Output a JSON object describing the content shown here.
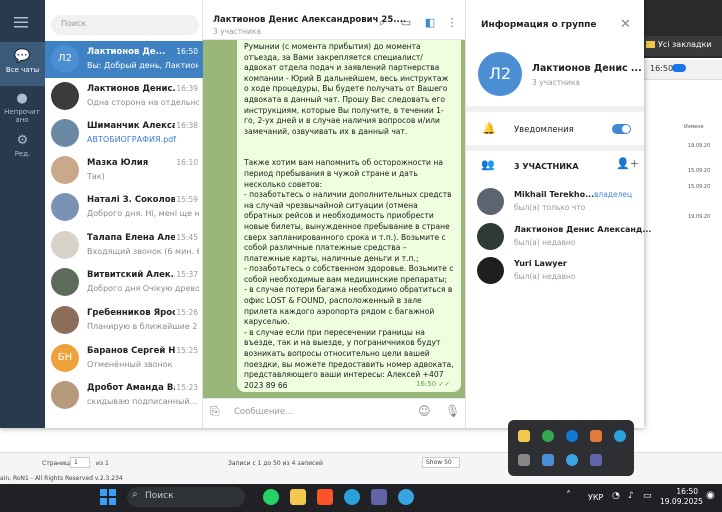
{
  "background_app": {
    "bookmarks_label": "Усі закладки",
    "clock": "16:50",
    "column_header": "Измене",
    "cells": [
      "19.09.20",
      "15.09.20",
      "15.09.20",
      "19.09.20"
    ],
    "footer": {
      "page_label": "Страница",
      "page_value": "1",
      "of_label": "из 1",
      "records": "Записи с 1 до 50 из 4 записей",
      "show": "Show 50",
      "copyright": "ain, RoN1 - All Rights Reserved v.2.3.234"
    }
  },
  "rail": [
    {
      "label": "Все чаты",
      "icon": "chats-icon"
    },
    {
      "label": "Непрочит ано",
      "icon": "unread-icon"
    },
    {
      "label": "Ред.",
      "icon": "edit-icon"
    }
  ],
  "search": {
    "placeholder": "Поиск"
  },
  "chats": [
    {
      "avatar": "Л2",
      "name": "Лактионов Де...",
      "time": "16:50",
      "preview": "Вы: Добрый день, Лактион...",
      "avatar_color": "#4c8ed4"
    },
    {
      "avatar": "",
      "name": "Лактионов Денис...",
      "time": "16:39",
      "preview": "Одна сторона на отдельно...",
      "avatar_color": "#3b3b3b"
    },
    {
      "avatar": "",
      "name": "Шиманчик Александ...",
      "time": "16:38",
      "preview": "АВТОБИОГРАФИЯ.pdf",
      "avatar_color": "#6a8aa3"
    },
    {
      "avatar": "",
      "name": "Мазка Юлия",
      "time": "16:10",
      "preview": "Так)",
      "avatar_color": "#c9a98a"
    },
    {
      "avatar": "",
      "name": "Наталі З. Соколова",
      "time": "15:59",
      "preview": "Доброго дня. Ні, мені ще н...",
      "avatar_color": "#7a93b5"
    },
    {
      "avatar": "",
      "name": "Талапа Елена Але...",
      "time": "15:45",
      "preview": "Входящий звонок (6 мин. 6 ...",
      "avatar_color": "#d9d2c8"
    },
    {
      "avatar": "",
      "name": "Витвитский Алек...",
      "time": "15:37",
      "preview": "Доброго дня Очікую древо",
      "avatar_color": "#5c6b5a"
    },
    {
      "avatar": "",
      "name": "Гребенников Яросла...",
      "time": "15:26",
      "preview": "Планирую в ближайшие 2 ...",
      "avatar_color": "#8a6e5a"
    },
    {
      "avatar": "БН",
      "name": "Баранов Сергей Н...",
      "time": "15:25",
      "preview": "Отменённый звонок",
      "avatar_color": "#f0a23a"
    },
    {
      "avatar": "",
      "name": "Дробот Аманда Влад...",
      "time": "15:23",
      "preview": "скидываю подписанный...",
      "avatar_color": "#b79a7a"
    }
  ],
  "conversation": {
    "title": "Лактионов Денис Александрович 25....",
    "subtitle": "3 участника",
    "message_part1": "Румынии (с момента прибытия) до момента отъезда, за Вами закрепляется специалист/адвокат отдела подач и заявлений партнерства компании - Юрий В дальнейшем, весь инструктаж о ходе процедуры, Вы будете получать от Вашего адвоката в данный чат. Прошу Вас следовать его инструкциям, которые Вы получите, в течении 1-го, 2-ух дней и в случае наличия вопросов и/или замечаний, озвучивать их в данный чат.",
    "message_part2": "Также хотим вам напомнить об осторожности на период пребывания в чужой стране и дать несколько советов:\n- позаботьтесь о наличии дополнительных средств на случай чрезвычайной ситуации (отмена обратных рейсов и необходимость приобрести новые билеты, вынужденное пребывание в стране сверх запланированного срока и т.п.). Возьмите с собой различные платежные средства – платежные карты, наличные деньги и т.п.;\n- позаботьтесь о собственном здоровье. Возьмите с собой необходимые вам медицинские препараты;\n- в случае потери багажа необходимо обратиться в офис LOST & FOUND, расположенный в зале прилета каждого аэропорта рядом с багажной каруселью.\n- в случае если при пересечении границы на въезде, так и на выезде, у пограничников будут возникать вопросы относительно цели вашей поездки, вы можете предоставить номер адвоката, представляющего ваши интересы: Алексей +407 2023 89 66",
    "time": "16:50",
    "composer_placeholder": "Сообщение..."
  },
  "info_panel": {
    "title": "Информация о группе",
    "avatar": "Л2",
    "name": "Лактионов Денис ...",
    "count": "3 участника",
    "notifications_label": "Уведомления",
    "notifications_on": true,
    "members_label": "3 УЧАСТНИКА",
    "members": [
      {
        "name": "Mikhail Terekho...",
        "status": "был(а) только что",
        "role": "владелец",
        "avatar_color": "#5b6470"
      },
      {
        "name": "Лактионов Денис Александ...",
        "status": "был(а) недавно",
        "role": "",
        "avatar_color": "#2f3a35"
      },
      {
        "name": "Yuri Lawyer",
        "status": "был(а) недавно",
        "role": "",
        "avatar_color": "#1e1e1e"
      }
    ]
  },
  "taskbar": {
    "search_label": "Поиск",
    "lang": "УКР",
    "time": "16:50",
    "date": "19.09.2025"
  }
}
